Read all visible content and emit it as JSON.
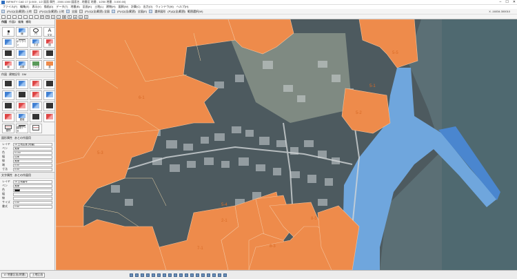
{
  "window": {
    "title": "INFINITY CAD 17 [1:500 , 1/2 図面 属性 , 2000.1000 図面名 , 地番区 地番 , 1/250 地番 , 0.000.00]",
    "controls": [
      "–",
      "☐",
      "✕"
    ]
  },
  "menu": [
    "ファイル(F)",
    "編集(E)",
    "表示(V)",
    "描画(D)",
    "データ(T)",
    "地番(B)",
    "区画(K)",
    "土地(L)",
    "建物(H)",
    "図郭(W)",
    "計算(C)",
    "出力(O)",
    "ウィンドウ(W)",
    "ヘルプ(H)"
  ],
  "toolbar1": {
    "labels": [
      "(P)/(Q)全(範囲) 土地",
      "(P)/(Q)全(範囲) 土地",
      "全図",
      "(P)/(Q)全(範囲) 全図",
      "(P)/(Q)全(範囲)",
      "全図(E)",
      "選択図形",
      "(P)(Q)全(範囲)",
      "範囲選択(W)"
    ]
  },
  "coordinates": {
    "x_label": "X",
    "x_value": "-16034.300010",
    "y_label": "Y",
    "y_value": "44975.409830"
  },
  "left_panel": {
    "tabs": [
      "作図",
      "作図2",
      "編集",
      "補助"
    ],
    "tools_row1": [
      "点",
      "線",
      "円",
      "文字"
    ],
    "tools_row2": [
      "",
      "ポリライン",
      "寸法",
      "図"
    ],
    "tools_row3": [
      "",
      "",
      "",
      ""
    ],
    "tools_row4": [
      "線",
      "点群",
      "ラスタ",
      "塗"
    ],
    "section2_tabs": [
      "作図",
      "建物記号",
      "DM"
    ],
    "tools_row5": [
      "",
      "",
      "",
      ""
    ],
    "tools_row6": [
      "",
      "",
      "",
      ""
    ],
    "tools_row7": [
      "",
      "",
      "",
      ""
    ],
    "tools_row8": [
      "",
      "重複",
      "",
      ""
    ],
    "tools_row9": [
      "建物",
      "建物データ",
      "",
      ""
    ],
    "props1": {
      "header": "図形属性",
      "header2": "あとの作図用",
      "rows": [
        {
          "label": "レイヤ",
          "value": "10 土地区画 (地番)"
        },
        {
          "label": "ペン",
          "value": "実線"
        },
        {
          "label": "色",
          "value": "0.100"
        },
        {
          "label": "幅",
          "value": "白黒"
        },
        {
          "label": "線",
          "value": "実線"
        },
        {
          "label": "端",
          "value": "0.00"
        },
        {
          "label": "寸法",
          "value": "0.00"
        }
      ]
    },
    "props2": {
      "header": "文字属性",
      "header2": "あとの作図用",
      "rows": [
        {
          "label": "レイヤ",
          "value": "10 土地番号"
        },
        {
          "label": "ペン",
          "value": "実線"
        },
        {
          "label": "色",
          "value": ""
        },
        {
          "label": "幅",
          "value": ""
        },
        {
          "label": "線",
          "value": ""
        },
        {
          "label": "サイズ",
          "value": "1.00"
        },
        {
          "label": "書式",
          "value": "2.50"
        },
        {
          "label": "書式2",
          "value": ""
        }
      ]
    },
    "swatch_color": "#111111"
  },
  "map": {
    "parcel_color": "#ee8b4b",
    "water_color": "#6fa6dd",
    "sea_color": "#5b6f75",
    "parcel_labels": [
      "5-5",
      "5-1",
      "5-2",
      "5-3",
      "5-4",
      "2-1",
      "7-1",
      "8-3",
      "6-1",
      "8-5"
    ]
  },
  "statusbar": {
    "layer": "10 地番区画(地番)",
    "mode": "土地区画"
  }
}
